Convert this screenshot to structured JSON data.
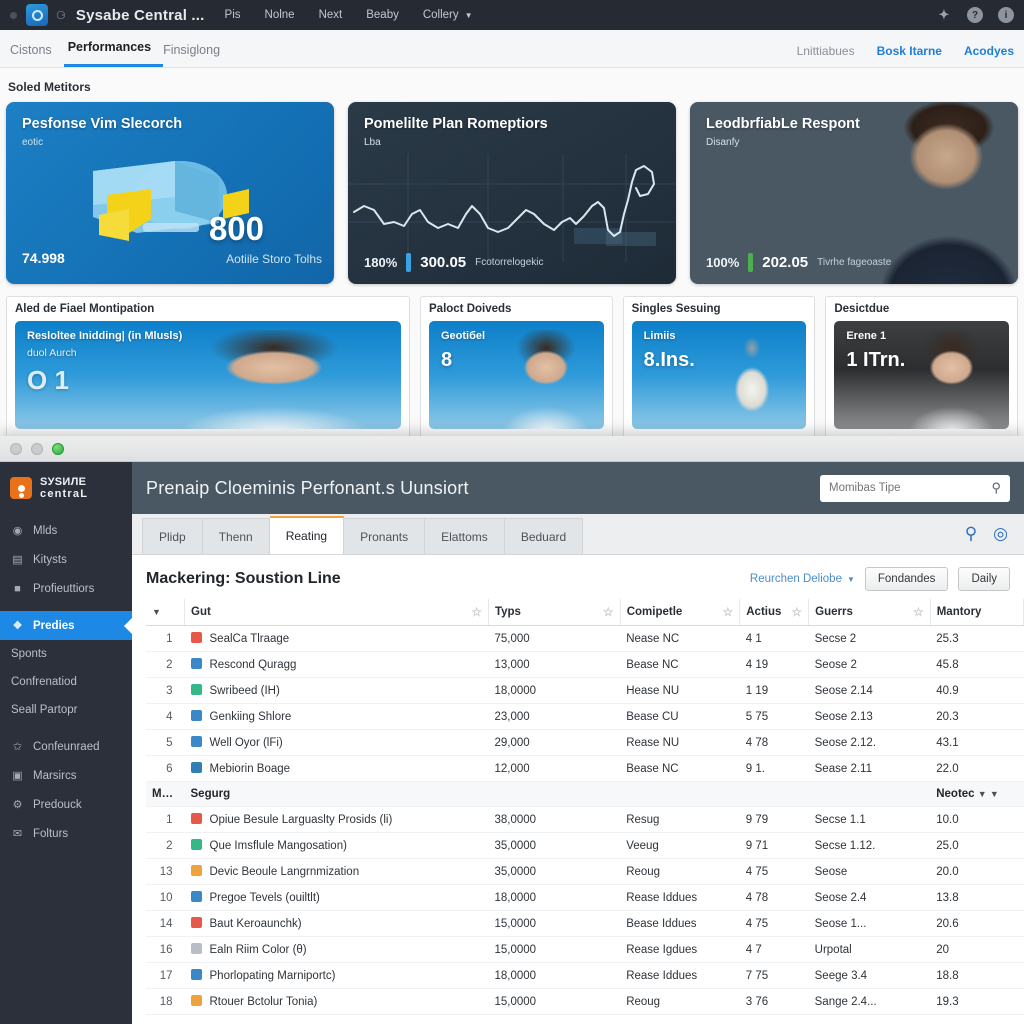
{
  "back_window": {
    "titlebar": {
      "app_title": "Sysabe Central ...",
      "spinner_icon": "refresh-icon",
      "menu": [
        "Pis",
        "Nolne",
        "Next",
        "Beaby",
        "Collery"
      ],
      "menu_caret_icon": "chevron-down-icon",
      "right_icons": [
        "sparkle-icon",
        "help-icon",
        "info-icon"
      ]
    },
    "subbar": {
      "tabs": [
        {
          "label": "Cistons",
          "active": false
        },
        {
          "label": "Performances",
          "active": true
        },
        {
          "label": "Finsiglong",
          "active": false
        }
      ],
      "right_links": [
        "Lnittiabues",
        "Bosk Itarne",
        "Acodyes"
      ]
    },
    "section_title": "Soled Metitors",
    "hero_cards": [
      {
        "title": "Pesfonse Vim Slecorch",
        "subtitle": "eotic",
        "pct": "74.998",
        "big_value": "800",
        "big_label": "Aotiile Storo Tolhs",
        "accent": "#f4d21a"
      },
      {
        "title": "Pomelilte Plan Romeptiors",
        "subtitle": "Lba",
        "pct": "180%",
        "value": "300.05",
        "label": "Fcotorrelogekic",
        "accent": "#3aa3e3"
      },
      {
        "title": "LeodbrfiabLe Respont",
        "subtitle": "Disanfy",
        "pct": "100%",
        "value": "202.05",
        "label": "Tivrhe fageoaste",
        "accent": "#4caf50"
      }
    ],
    "section2_titles": [
      "Aled de Fiael Montipation",
      "Paloct Doiveds",
      "Singles Sesuing",
      "Desictdue"
    ],
    "mini_cards": [
      {
        "label": "Resloltee Inidding| (in Mlusls)",
        "sub": "duol Aurch",
        "value": "O 1",
        "theme": "blue"
      },
      {
        "label": "Geotiбel",
        "value": "8",
        "theme": "blue"
      },
      {
        "label": "Limiis",
        "value": "8.Ins.",
        "theme": "blue"
      },
      {
        "label": "Erene 1",
        "value": "1 ITrn.",
        "theme": "dark"
      }
    ]
  },
  "front_window": {
    "traffic_lights": [
      "close",
      "minimize",
      "zoom"
    ],
    "sidebar": {
      "brand_line1": "SУSИЛЕ",
      "brand_line2": "centraL",
      "brand_icon": "person-mark-icon",
      "items": [
        {
          "label": "Mlds",
          "icon": "dashboard-icon",
          "active": false
        },
        {
          "label": "Kitysts",
          "icon": "chart-icon",
          "active": false
        },
        {
          "label": "Profieuttiors",
          "icon": "briefcase-icon",
          "active": false
        },
        {
          "label": "Predies",
          "icon": "star-badge-icon",
          "active": true
        },
        {
          "label": "Sponts",
          "icon": "",
          "active": false
        },
        {
          "label": "Confrenatiod",
          "icon": "",
          "active": false
        },
        {
          "label": "Seall Partopr",
          "icon": "",
          "active": false
        },
        {
          "label": "Confeunraed",
          "icon": "wrench-icon",
          "active": false
        },
        {
          "label": "Marsircs",
          "icon": "book-icon",
          "active": false
        },
        {
          "label": "Predouck",
          "icon": "gear-icon",
          "active": false
        },
        {
          "label": "Folturs",
          "icon": "mail-icon",
          "active": false
        }
      ]
    },
    "header": {
      "title": "Prenaip Cloeminis Perfonant.s Uunsiort",
      "search_placeholder": "Momibas Tipe",
      "search_value": "",
      "search_icon": "search-icon"
    },
    "tabs": [
      {
        "label": "Plidp",
        "active": false
      },
      {
        "label": "Thenn",
        "active": false
      },
      {
        "label": "Reating",
        "active": true
      },
      {
        "label": "Pronants",
        "active": false
      },
      {
        "label": "Elattoms",
        "active": false
      },
      {
        "label": "Beduard",
        "active": false
      }
    ],
    "tabs_right_icons": [
      "search-icon",
      "locate-icon"
    ],
    "toolbar": {
      "heading": "Mackering: Soustion Line",
      "dropdown_label": "Reurchen Deliobe",
      "dropdown_caret_icon": "chevron-down-icon",
      "button_1": "Fondandes",
      "button_2": "Daily"
    },
    "table": {
      "columns": [
        {
          "key": "n",
          "label": "",
          "caret": true
        },
        {
          "key": "name",
          "label": "Gut",
          "sort_icon": "sort-icon"
        },
        {
          "key": "type",
          "label": "Typs",
          "sort_icon": "sort-icon"
        },
        {
          "key": "competle",
          "label": "Comipetle",
          "sort_icon": "sort-icon"
        },
        {
          "key": "actius",
          "label": "Actius",
          "sort_icon": "sort-icon"
        },
        {
          "key": "guerrs",
          "label": "Guerrs",
          "sort_icon": "sort-icon"
        },
        {
          "key": "mantory",
          "label": "Mantory"
        }
      ],
      "group_1_rows": [
        {
          "n": "1",
          "color": "#e5584a",
          "name": "SealCa Tlraage",
          "type": "75,000",
          "competle": "Nease NC",
          "actius": "4 1",
          "guerrs": "Secse 2",
          "mantory": "25.3"
        },
        {
          "n": "2",
          "color": "#3b87c7",
          "name": "Rescond Quragg",
          "type": "13,000",
          "competle": "Bease NC",
          "actius": "4 19",
          "guerrs": "Seose 2",
          "mantory": "45.8"
        },
        {
          "n": "3",
          "color": "#35b888",
          "name": "Swribeed (IH)",
          "type": "18,0000",
          "competle": "Hease NU",
          "actius": "1 19",
          "guerrs": "Seose 2.14",
          "mantory": "40.9"
        },
        {
          "n": "4",
          "color": "#3b87c7",
          "name": "Genkiing Shlore",
          "type": "23,000",
          "competle": "Bease CU",
          "actius": "5 75",
          "guerrs": "Seose 2.13",
          "mantory": "20.3"
        },
        {
          "n": "5",
          "color": "#3b87c7",
          "name": "Well Oyor (lFi)",
          "type": "29,000",
          "competle": "Rease NU",
          "actius": "4 78",
          "guerrs": "Seose 2.12.",
          "mantory": "43.1"
        },
        {
          "n": "6",
          "color": "#2f7fb5",
          "name": "Mebiorin Boage",
          "type": "12,000",
          "competle": "Bease NC",
          "actius": "9 1.",
          "guerrs": "Sease 2.11",
          "mantory": "22.0"
        }
      ],
      "group_header": {
        "left": "Mu:",
        "left_caret_icon": "chevron-down-icon",
        "label": "Segurg",
        "right": "Neotec",
        "right_caret_icon": "chevron-down-icon"
      },
      "group_2_rows": [
        {
          "n": "1",
          "color": "#e5584a",
          "name": "Opiue Besule Larguaslty Prosids (li)",
          "type": "38,0000",
          "competle": "Resug",
          "actius": "9 79",
          "guerrs": "Secse 1.1",
          "mantory": "10.0"
        },
        {
          "n": "2",
          "color": "#35b888",
          "name": "Que Imsflule Mangosation)",
          "type": "35,0000",
          "competle": "Veeug",
          "actius": "9 71",
          "guerrs": "Secse 1.12.",
          "mantory": "25.0"
        },
        {
          "n": "13",
          "color": "#f0a33c",
          "name": "Devic Beoule Langrnmization",
          "type": "35,0000",
          "competle": "Reoug",
          "actius": "4 75",
          "guerrs": "Seose",
          "mantory": "20.0"
        },
        {
          "n": "10",
          "color": "#3b87c7",
          "name": "Pregoe Tevels (ouiltlt)",
          "type": "18,0000",
          "competle": "Rease Iddues",
          "actius": "4 78",
          "guerrs": "Seose 2.4",
          "mantory": "13.8"
        },
        {
          "n": "14",
          "color": "#e5584a",
          "name": "Baut Keroaunchk)",
          "type": "15,0000",
          "competle": "Bease Iddues",
          "actius": "4 75",
          "guerrs": "Seose 1...",
          "mantory": "20.6"
        },
        {
          "n": "16",
          "color": "#b9bec4",
          "name": "Ealn Riim Color (θ)",
          "type": "15,0000",
          "competle": "Rease Igdues",
          "actius": "4 7",
          "guerrs": "Urpotal",
          "mantory": "20"
        },
        {
          "n": "17",
          "color": "#3b87c7",
          "name": "Phorlopating Marniportc)",
          "type": "18,0000",
          "competle": "Rease Iddues",
          "actius": "7 75",
          "guerrs": "Seege 3.4",
          "mantory": "18.8"
        },
        {
          "n": "18",
          "color": "#f0a33c",
          "name": "Rtouer Bctolur Tonia)",
          "type": "15,0000",
          "competle": "Reoug",
          "actius": "3 76",
          "guerrs": "Sange 2.4...",
          "mantory": "19.3"
        }
      ]
    }
  }
}
